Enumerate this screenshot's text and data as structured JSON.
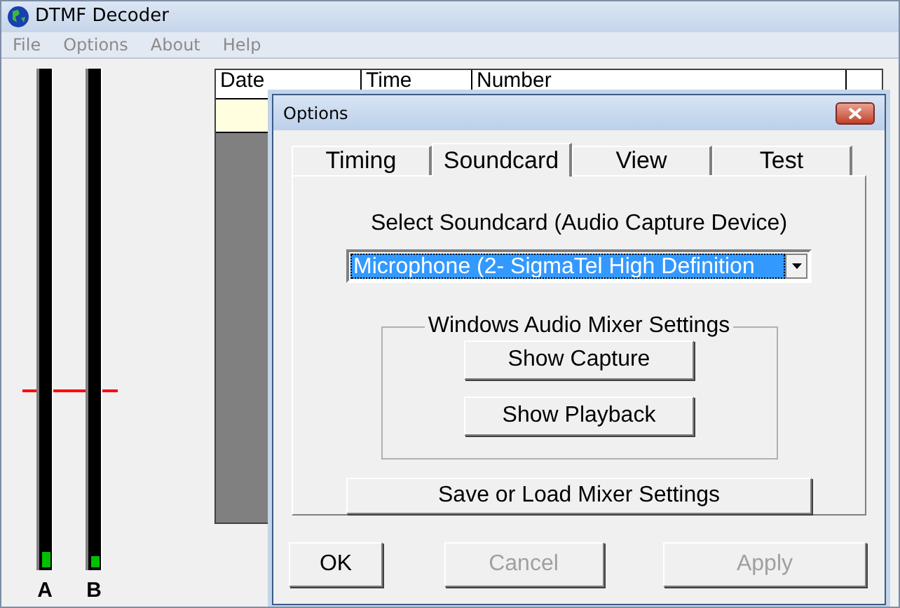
{
  "window": {
    "title": "DTMF Decoder"
  },
  "menu": [
    "File",
    "Options",
    "About",
    "Help"
  ],
  "meters": [
    {
      "label": "A",
      "level": 0.03
    },
    {
      "label": "B",
      "level": 0.02
    }
  ],
  "threshold": {
    "level": 0.36
  },
  "table": {
    "columns": [
      "Date",
      "Time",
      "Number"
    ]
  },
  "dialog": {
    "title": "Options",
    "tabs": [
      {
        "label": "Timing",
        "selected": false
      },
      {
        "label": "Soundcard",
        "selected": true
      },
      {
        "label": "View",
        "selected": false
      },
      {
        "label": "Test",
        "selected": false
      }
    ],
    "device_label": "Select Soundcard (Audio Capture Device)",
    "device_value": "Microphone (2- SigmaTel High Definition",
    "group_title": "Windows Audio Mixer Settings",
    "group_buttons": [
      "Show Capture",
      "Show Playback"
    ],
    "save_button": "Save or Load Mixer Settings",
    "buttons": [
      {
        "label": "OK",
        "disabled": false
      },
      {
        "label": "Cancel",
        "disabled": true
      },
      {
        "label": "Apply",
        "disabled": true
      }
    ]
  }
}
